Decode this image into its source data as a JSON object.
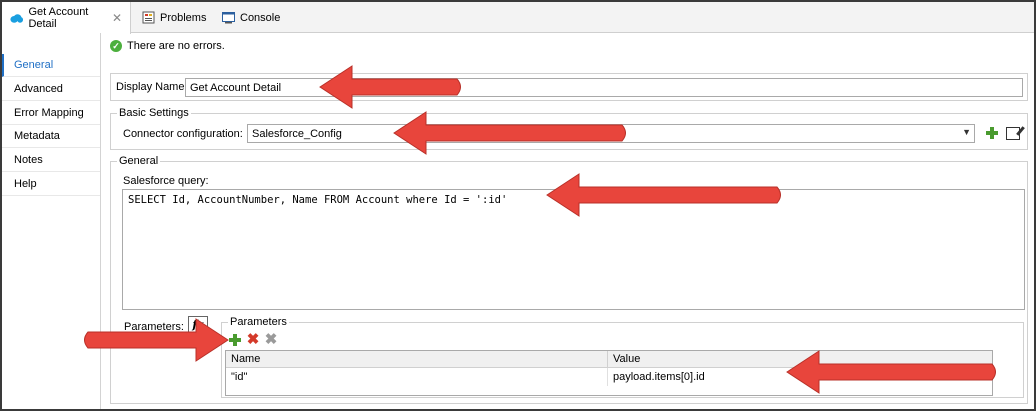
{
  "tabs": [
    {
      "label": "Get Account Detail",
      "active": true
    },
    {
      "label": "Problems",
      "active": false
    },
    {
      "label": "Console",
      "active": false
    }
  ],
  "nav": [
    {
      "label": "General",
      "active": true
    },
    {
      "label": "Advanced",
      "active": false
    },
    {
      "label": "Error Mapping",
      "active": false
    },
    {
      "label": "Metadata",
      "active": false
    },
    {
      "label": "Notes",
      "active": false
    },
    {
      "label": "Help",
      "active": false
    }
  ],
  "status": {
    "message": "There are no errors."
  },
  "display_name": {
    "label": "Display Name:",
    "value": "Get Account Detail"
  },
  "basic_settings": {
    "title": "Basic Settings",
    "connector_label": "Connector configuration:",
    "connector_value": "Salesforce_Config"
  },
  "general": {
    "title": "General",
    "query_label": "Salesforce query:",
    "query_value": "SELECT Id, AccountNumber, Name FROM Account where Id = ':id'",
    "parameters_label": "Parameters:",
    "fx_label": "fx"
  },
  "parameters": {
    "title": "Parameters",
    "columns": [
      "Name",
      "Value"
    ],
    "rows": [
      {
        "name": "\"id\"",
        "value": "payload.items[0].id"
      }
    ]
  },
  "colors": {
    "accent": "#1f6fc5",
    "arrow": "#e8453c",
    "success": "#4caf3d"
  }
}
